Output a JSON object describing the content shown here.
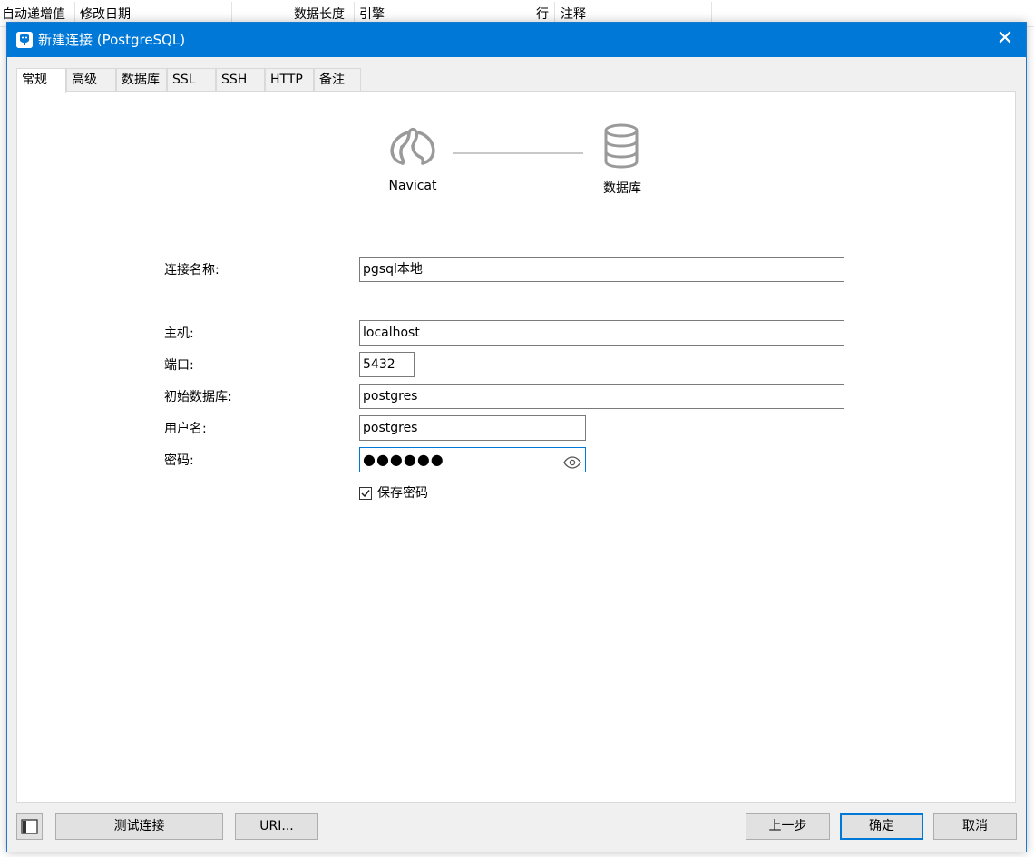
{
  "background_table": {
    "columns": [
      "自动递增值",
      "修改日期",
      "数据长度",
      "引擎",
      "行",
      "注释"
    ]
  },
  "dialog": {
    "title": "新建连接 (PostgreSQL)",
    "close_glyph": "✕"
  },
  "tabs": [
    {
      "label": "常规",
      "active": true
    },
    {
      "label": "高级",
      "active": false
    },
    {
      "label": "数据库",
      "active": false
    },
    {
      "label": "SSL",
      "active": false
    },
    {
      "label": "SSH",
      "active": false
    },
    {
      "label": "HTTP",
      "active": false
    },
    {
      "label": "备注",
      "active": false
    }
  ],
  "diagram": {
    "left_label": "Navicat",
    "right_label": "数据库",
    "left_icon": "navicat-logo-icon",
    "right_icon": "database-icon"
  },
  "form": {
    "connection_name": {
      "label": "连接名称:",
      "value": "pgsql本地"
    },
    "host": {
      "label": "主机:",
      "value": "localhost"
    },
    "port": {
      "label": "端口:",
      "value": "5432"
    },
    "initial_database": {
      "label": "初始数据库:",
      "value": "postgres"
    },
    "username": {
      "label": "用户名:",
      "value": "postgres"
    },
    "password": {
      "label": "密码:",
      "masked_value": "●●●●●●"
    },
    "save_password": {
      "label": "保存密码",
      "checked": true
    }
  },
  "buttons": {
    "test_connection": "测试连接",
    "uri": "URI...",
    "previous": "上一步",
    "ok": "确定",
    "cancel": "取消"
  },
  "colors": {
    "titlebar": "#0078d7",
    "dialog_bg": "#f0f0f0",
    "icon_gray": "#9a9a9a"
  }
}
